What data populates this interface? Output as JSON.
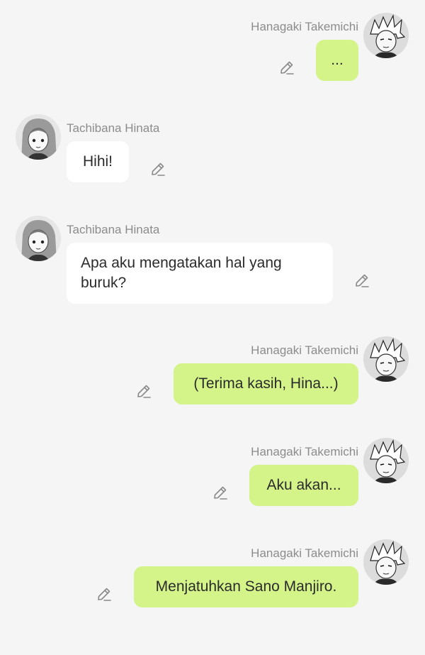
{
  "messages": [
    {
      "sender": "Hanagaki Takemichi",
      "side": "right",
      "text": "...",
      "avatar_icon": "takemichi-avatar-icon"
    },
    {
      "sender": "Tachibana Hinata",
      "side": "left",
      "text": "Hihi!",
      "avatar_icon": "hinata-avatar-icon"
    },
    {
      "sender": "Tachibana Hinata",
      "side": "left",
      "text": "Apa aku mengatakan hal yang buruk?",
      "avatar_icon": "hinata-avatar-icon"
    },
    {
      "sender": "Hanagaki Takemichi",
      "side": "right",
      "text": "(Terima kasih, Hina...)",
      "avatar_icon": "takemichi-avatar-icon"
    },
    {
      "sender": "Hanagaki Takemichi",
      "side": "right",
      "text": "Aku akan...",
      "avatar_icon": "takemichi-avatar-icon"
    },
    {
      "sender": "Hanagaki Takemichi",
      "side": "right",
      "text": "Menjatuhkan Sano Manjiro.",
      "avatar_icon": "takemichi-avatar-icon"
    }
  ],
  "icons": {
    "edit": "pencil-edit-icon"
  },
  "colors": {
    "background": "#f5f5f5",
    "outgoing_bubble": "#d4f48a",
    "incoming_bubble": "#ffffff",
    "sender_name": "#8c8c8c",
    "message_text": "#2b2b2b"
  }
}
